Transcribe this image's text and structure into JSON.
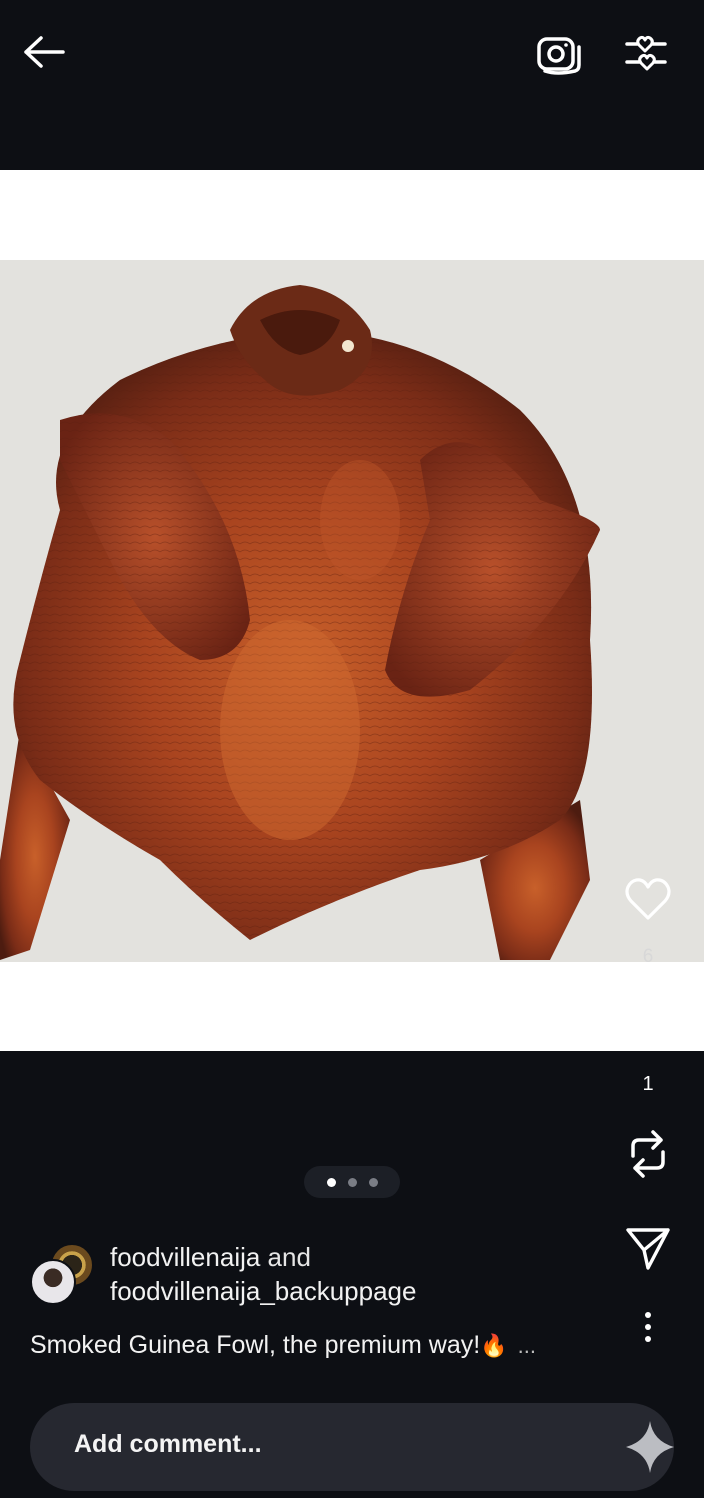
{
  "post": {
    "authors": {
      "primary": "foodvillenaija",
      "joiner": " and",
      "secondary": "foodvillenaija_backuppage"
    },
    "caption": {
      "text": "Smoked Guinea Fowl, the premium way!",
      "emoji": "🔥",
      "more": "..."
    },
    "media": {
      "pagination": {
        "total": 3,
        "active_index": 0
      }
    }
  },
  "actions": {
    "like": {
      "icon": "heart-icon",
      "count": "6"
    },
    "comment": {
      "icon": "comment-bubble-icon",
      "count": "1"
    },
    "repost": {
      "icon": "repost-icon"
    },
    "share": {
      "icon": "send-icon"
    },
    "more": {
      "icon": "more-vertical-icon"
    }
  },
  "topbar": {
    "back_icon": "arrow-left-icon",
    "camera_icon": "camera-icon",
    "filter_icon": "sliders-heart-icon"
  },
  "comment_bar": {
    "placeholder": "Add comment...",
    "icon": "sparkle-icon"
  },
  "colors": {
    "background": "#0d0f14",
    "media_frame": "#ffffff",
    "comment_bar": "#262830"
  }
}
